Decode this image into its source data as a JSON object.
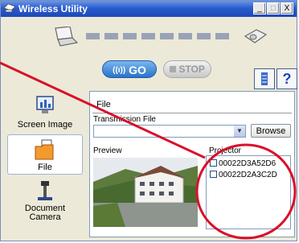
{
  "window": {
    "title": "Wireless Utility"
  },
  "titlebar_buttons": {
    "minimize": "_",
    "maximize": "□",
    "close": "X"
  },
  "controls": {
    "go_label": "GO",
    "stop_label": "STOP",
    "help_label": "?"
  },
  "sidebar": {
    "items": [
      {
        "label": "Screen Image",
        "icon": "screen-image-icon"
      },
      {
        "label": "File",
        "icon": "file-folder-icon",
        "selected": true
      },
      {
        "label": "Document",
        "label2": "Camera",
        "icon": "document-camera-icon"
      }
    ]
  },
  "panel": {
    "title": "File",
    "transmission_label": "Transmission File",
    "file_value": "",
    "browse_label": "Browse",
    "preview_label": "Preview",
    "projector_label": "Projector",
    "projectors": [
      {
        "id": "00022D3A52D6",
        "checked": false
      },
      {
        "id": "00022D2A3C2D",
        "checked": false
      }
    ]
  },
  "annotation": {
    "color": "#d9102c"
  }
}
